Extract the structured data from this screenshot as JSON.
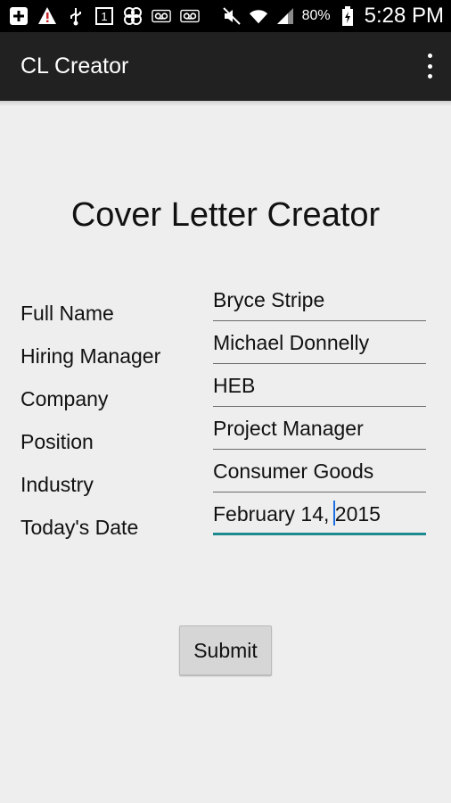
{
  "status_bar": {
    "battery_percent": "80%",
    "time": "5:28 PM",
    "icons": [
      "plus-box-icon",
      "warning-icon",
      "usb-icon",
      "notification-1-icon",
      "clover-icon",
      "voicemail-icon",
      "voicemail-icon",
      "mute-icon",
      "wifi-icon",
      "signal-icon",
      "battery-charging-icon"
    ]
  },
  "action_bar": {
    "title": "CL Creator",
    "overflow_icon": "overflow-menu-icon"
  },
  "heading": "Cover Letter Creator",
  "form": {
    "labels": [
      "Full Name",
      "Hiring Manager",
      "Company",
      "Position",
      "Industry",
      "Today's Date"
    ],
    "values": [
      "Bryce Stripe",
      "Michael Donnelly",
      "HEB",
      "Project Manager",
      "Consumer Goods",
      "February 14, 2015"
    ]
  },
  "submit_label": "Submit",
  "colors": {
    "accent": "#1d8a8f",
    "background": "#eeeeee",
    "action_bar": "#212121"
  }
}
